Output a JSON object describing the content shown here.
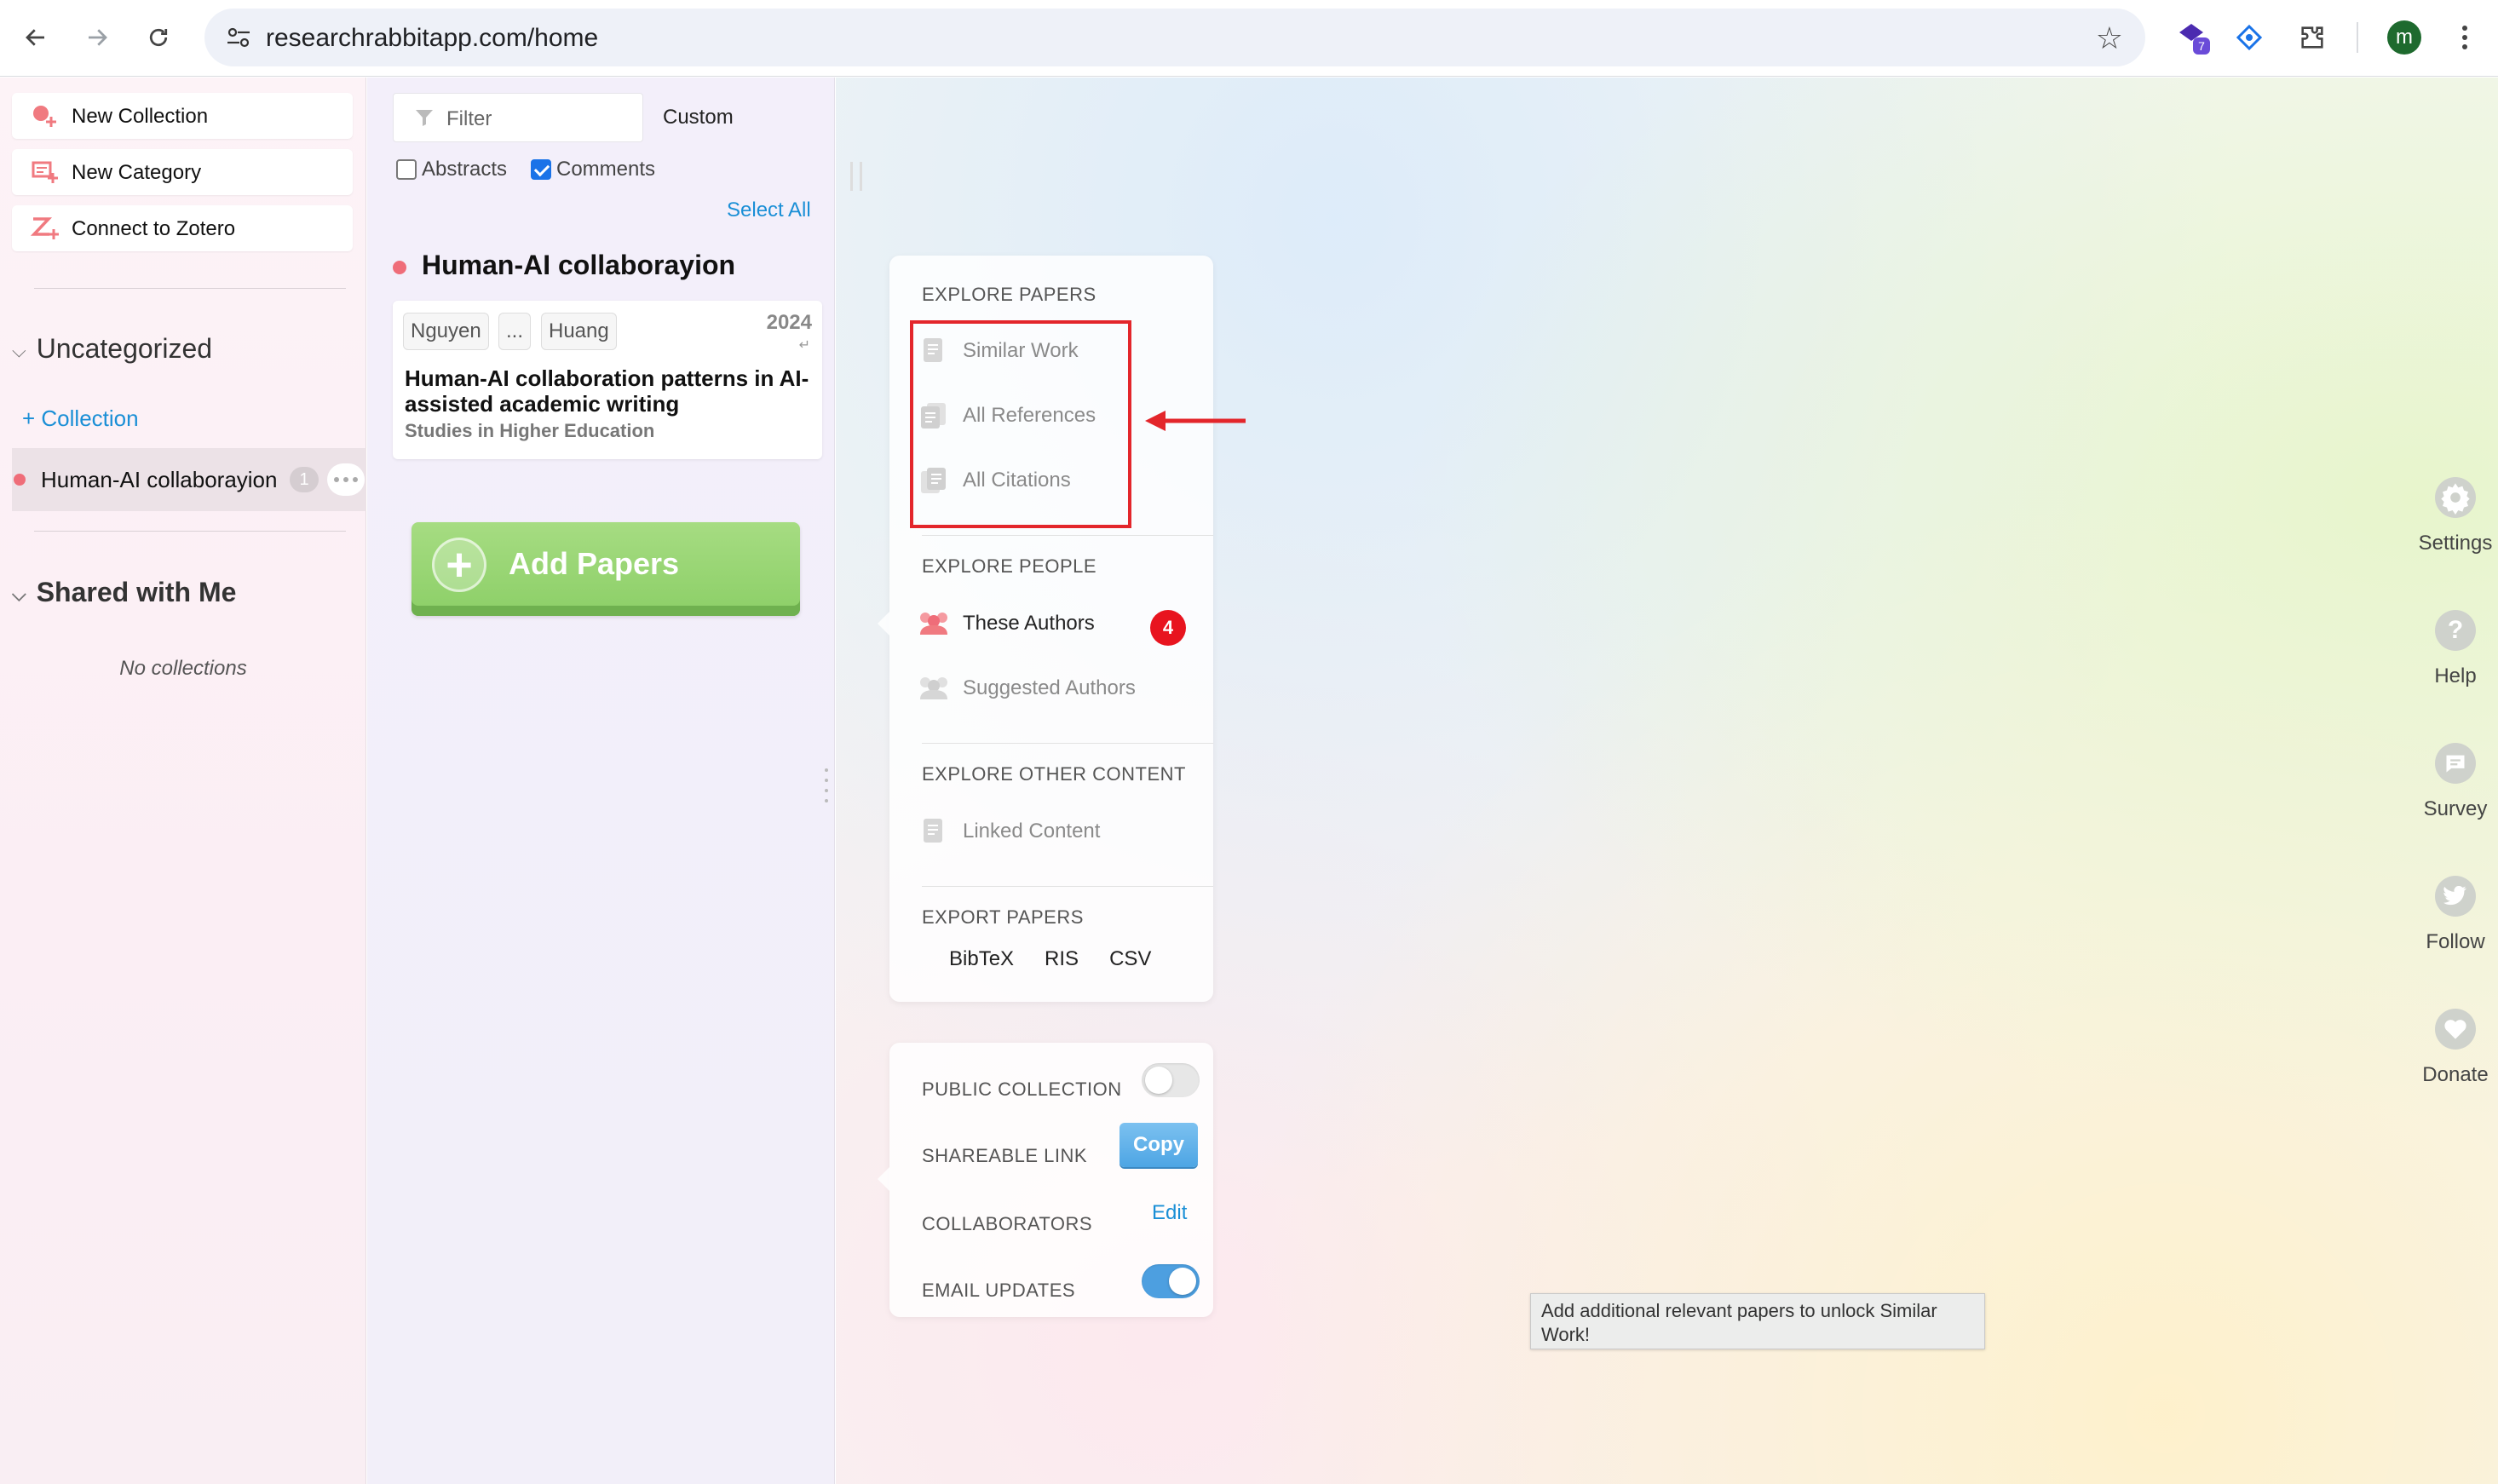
{
  "browser": {
    "url": "researchrabbitapp.com/home",
    "extension_badge": "7",
    "profile_initial": "m"
  },
  "sidebar": {
    "actions": [
      {
        "label": "New Collection"
      },
      {
        "label": "New Category"
      },
      {
        "label": "Connect to Zotero"
      }
    ],
    "uncategorized_title": "Uncategorized",
    "add_collection_label": "+ Collection",
    "collection": {
      "name": "Human-AI collaborayion",
      "count": "1"
    },
    "shared_title": "Shared with Me",
    "no_collections": "No collections"
  },
  "middle": {
    "filter_placeholder": "Filter",
    "sort_label": "Custom",
    "abstracts_label": "Abstracts",
    "comments_label": "Comments",
    "select_all": "Select All",
    "group_title": "Human-AI collaborayion",
    "paper": {
      "authors": [
        "Nguyen",
        "...",
        "Huang"
      ],
      "year": "2024",
      "title": "Human-AI collaboration patterns in AI-assisted academic writing",
      "venue": "Studies in Higher Education"
    },
    "add_papers_label": "Add Papers"
  },
  "explore": {
    "papers_label": "EXPLORE PAPERS",
    "similar_work": "Similar Work",
    "all_references": "All References",
    "all_citations": "All Citations",
    "people_label": "EXPLORE PEOPLE",
    "these_authors": "These Authors",
    "these_authors_count": "4",
    "suggested_authors": "Suggested Authors",
    "other_label": "EXPLORE OTHER CONTENT",
    "linked_content": "Linked Content",
    "export_label": "EXPORT PAPERS",
    "export_formats": [
      "BibTeX",
      "RIS",
      "CSV"
    ]
  },
  "collection_settings": {
    "public_label": "PUBLIC COLLECTION",
    "public_on": false,
    "shareable_label": "SHAREABLE LINK",
    "copy_label": "Copy",
    "collaborators_label": "COLLABORATORS",
    "edit_label": "Edit",
    "email_label": "EMAIL UPDATES",
    "email_on": true
  },
  "tooltip": "Add additional relevant papers to unlock Similar Work!",
  "rail": [
    {
      "label": "Settings",
      "icon": "gear-icon"
    },
    {
      "label": "Help",
      "icon": "question-icon"
    },
    {
      "label": "Survey",
      "icon": "survey-icon"
    },
    {
      "label": "Follow",
      "icon": "twitter-icon"
    },
    {
      "label": "Donate",
      "icon": "heart-icon"
    }
  ],
  "colors": {
    "accent_blue": "#1a8fd6",
    "highlight_red": "#e3262b",
    "add_green": "#8ccf67",
    "collection_dot": "#ef6d79"
  }
}
